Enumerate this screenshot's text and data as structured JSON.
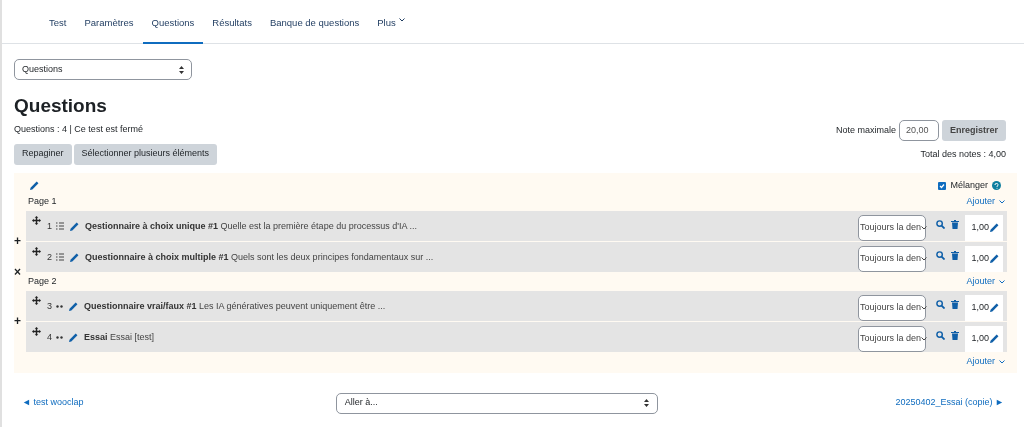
{
  "tabs": [
    {
      "label": "Test",
      "selected": false,
      "dropdown": false
    },
    {
      "label": "Paramètres",
      "selected": false,
      "dropdown": false
    },
    {
      "label": "Questions",
      "selected": true,
      "dropdown": false
    },
    {
      "label": "Résultats",
      "selected": false,
      "dropdown": false
    },
    {
      "label": "Banque de questions",
      "selected": false,
      "dropdown": false
    },
    {
      "label": "Plus",
      "selected": false,
      "dropdown": true
    }
  ],
  "view_select": {
    "value": "Questions"
  },
  "heading": "Questions",
  "summary": "Questions : 4 | Ce test est fermé",
  "buttons": [
    "Repaginer",
    "Sélectionner plusieurs éléments"
  ],
  "max_grade": {
    "label": "Note maximale",
    "value": "20,00",
    "button": "Enregistrer"
  },
  "total": "Total des notes : 4,00",
  "shuffle": {
    "label": "Mélanger",
    "checked": true
  },
  "pages": [
    {
      "title": "Page 1",
      "add": "Ajouter",
      "questions": [
        {
          "number": "1",
          "kind": "choice",
          "name": "Qestionnaire à choix unique #1",
          "text": "Quelle est la première étape du processus d'IA ...",
          "display": "Toujours la den",
          "mark": "1,00",
          "break_icon": "+"
        },
        {
          "number": "2",
          "kind": "choice",
          "name": "Questionnaire à choix multiple #1",
          "text": "Quels sont les deux principes fondamentaux sur ...",
          "display": "Toujours la den",
          "mark": "1,00",
          "break_icon": "×"
        }
      ]
    },
    {
      "title": "Page 2",
      "add": "Ajouter",
      "questions": [
        {
          "number": "3",
          "kind": "dots",
          "name": "Questionnaire vrai/faux #1",
          "text": "Les IA génératives peuvent uniquement être ...",
          "display": "Toujours la den",
          "mark": "1,00",
          "break_icon": "+"
        },
        {
          "number": "4",
          "kind": "dots",
          "name": "Essai",
          "text": "Essai [test]",
          "display": "Toujours la den",
          "mark": "1,00"
        }
      ]
    }
  ],
  "final_add": "Ajouter",
  "footer": {
    "previous": "◄ test wooclap",
    "jump": "Aller à...",
    "next": "20250402_Essai (copie) ►"
  }
}
